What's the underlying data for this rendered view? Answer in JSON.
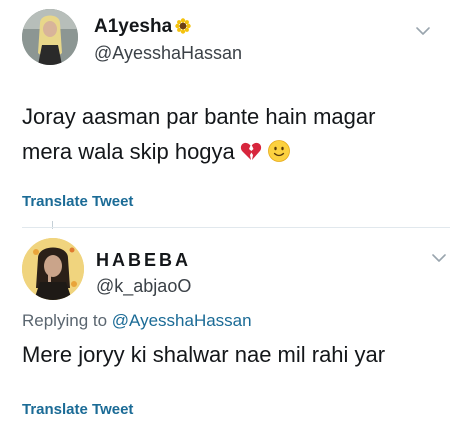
{
  "tweets": [
    {
      "display_name": "A1yesha",
      "name_emoji": "sunflower-icon",
      "handle": "@AyesshaHassan",
      "text_line_1": "Joray aasman par bante hain magar",
      "text_line_2": "mera wala skip hogya",
      "text_emojis": [
        "broken-heart-icon",
        "slightly-smiling-face-icon"
      ],
      "translate_label": "Translate Tweet"
    },
    {
      "display_name": "HABEBA",
      "handle": "@k_abjaoO",
      "replying_prefix": "Replying to",
      "replying_to": "@AyesshaHassan",
      "text": "Mere joryy ki shalwar nae mil rahi yar",
      "translate_label": "Translate Tweet"
    }
  ],
  "colors": {
    "link": "#1b6b96",
    "text": "#14171a",
    "secondary": "#5b6670",
    "divider": "#e1e8ed"
  }
}
